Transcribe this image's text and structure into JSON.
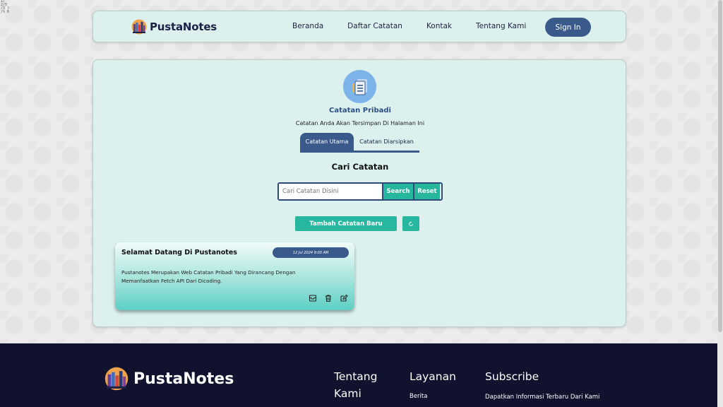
{
  "corner_note": "1/ 2/5 /3 ? /% 6",
  "brand": {
    "name_prefix": "Pusta",
    "name_suffix": "Notes",
    "footer_name": "PustaNotes"
  },
  "nav": {
    "links": [
      "Beranda",
      "Daftar Catatan",
      "Kontak",
      "Tentang Kami"
    ],
    "signin_label": "Sign In"
  },
  "main": {
    "title": "Catatan Pribadi",
    "subtitle": "Catatan Anda Akan Tersimpan Di Halaman Ini",
    "tabs": [
      {
        "label": "Catatan Utama",
        "active": true
      },
      {
        "label": "Catatan Diarsipkan",
        "active": false
      }
    ],
    "search_title": "Cari Catatan",
    "search_placeholder": "Cari Catatan Disini",
    "search_label": "Search",
    "reset_label": "Reset",
    "add_label": "Tambah Catatan Baru"
  },
  "notes": [
    {
      "title": "Selamat Datang Di Pustanotes",
      "date": "12 Jul 2024 9:00 AM",
      "body": "Pustanotes Merupakan Web Catatan Pribadi Yang Dirancang Dengan Memanfaatkan Fetch API Dari Dicoding."
    }
  ],
  "footer": {
    "about_heading_1": "Tentang",
    "about_heading_2": "Kami",
    "services_heading": "Layanan",
    "services_link": "Berita",
    "subscribe_heading": "Subscribe",
    "subscribe_text": "Dapatkan Informasi Terbaru Dari Kami"
  },
  "colors": {
    "primary": "#3a5a8c",
    "accent": "#27b79f",
    "panel": "#dcf1ee",
    "footer": "#10122e"
  }
}
